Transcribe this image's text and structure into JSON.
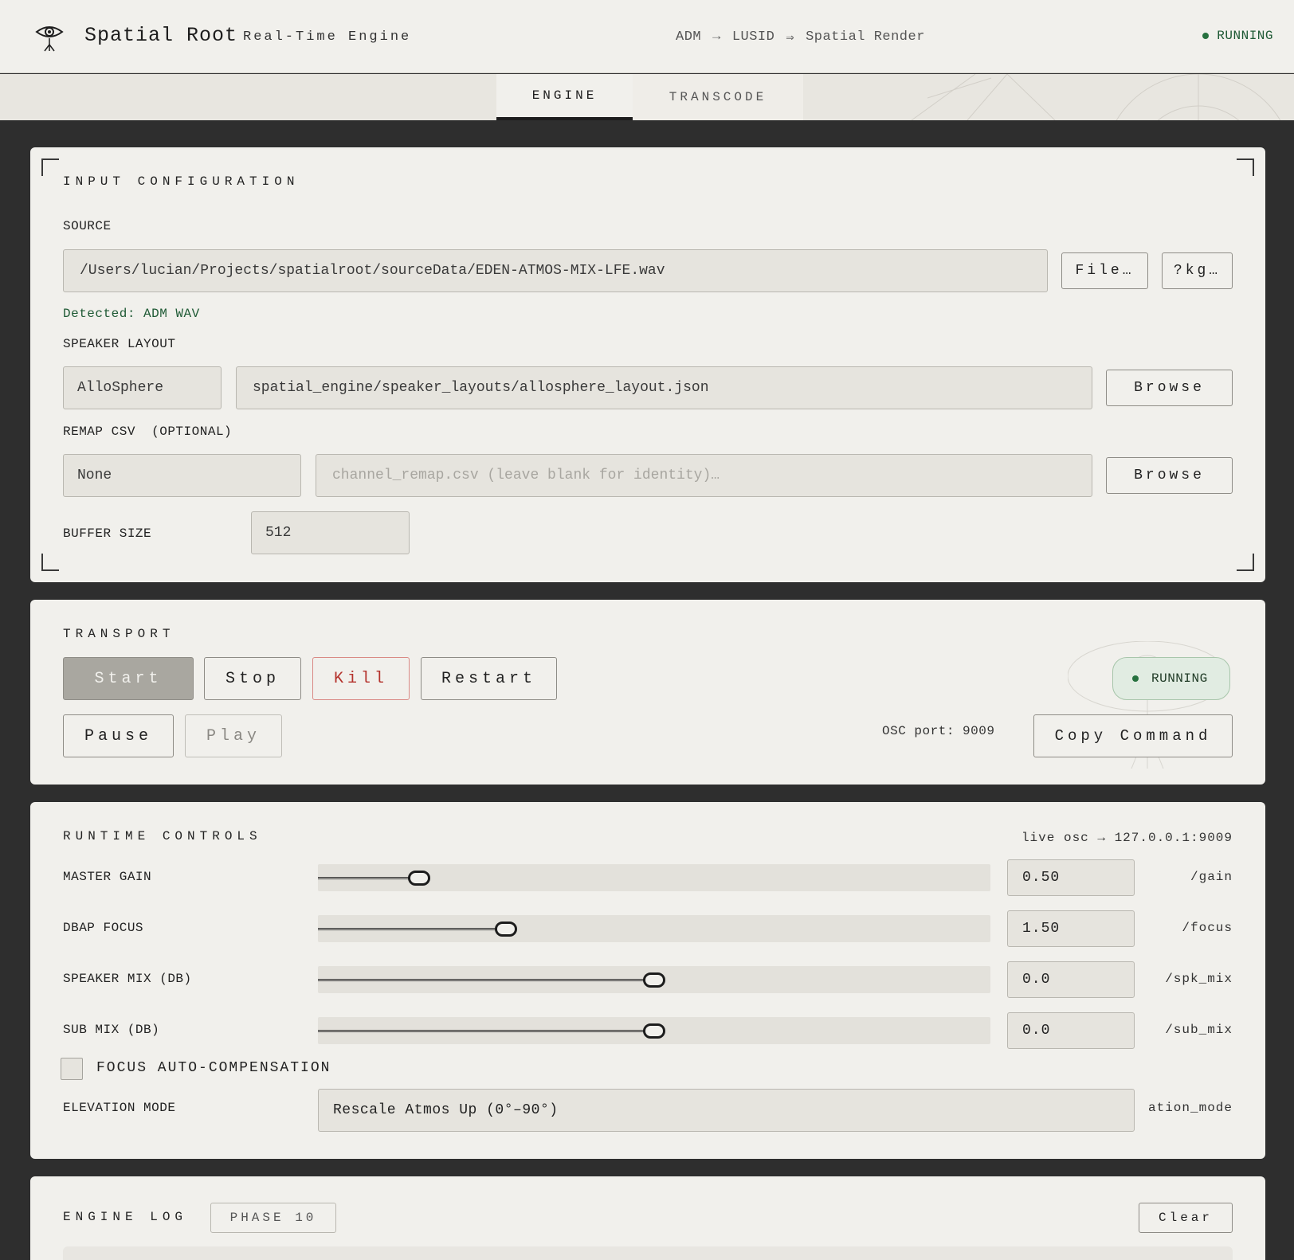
{
  "header": {
    "title": "Spatial Root",
    "subtitle": "Real-Time Engine",
    "pipeline": [
      "ADM",
      "→",
      "LUSID",
      "⇒",
      "Spatial Render"
    ],
    "status": "RUNNING"
  },
  "tabs": [
    {
      "label": "ENGINE",
      "active": true
    },
    {
      "label": "TRANSCODE",
      "active": false
    }
  ],
  "input_config": {
    "title": "INPUT CONFIGURATION",
    "source_label": "SOURCE",
    "source_value": "/Users/lucian/Projects/spatialroot/sourceData/EDEN-ATMOS-MIX-LFE.wav",
    "file_button": "File…",
    "pkg_button": "?kg…",
    "detected": "Detected: ADM WAV",
    "speaker_layout_label": "SPEAKER LAYOUT",
    "speaker_layout_preset": "AlloSphere",
    "speaker_layout_path": "spatial_engine/speaker_layouts/allosphere_layout.json",
    "browse_label": "Browse",
    "remap_label": "REMAP CSV",
    "remap_optional": "(OPTIONAL)",
    "remap_preset": "None",
    "remap_placeholder": "channel_remap.csv (leave blank for identity)…",
    "buffer_label": "BUFFER SIZE",
    "buffer_value": "512"
  },
  "transport": {
    "title": "TRANSPORT",
    "start": "Start",
    "stop": "Stop",
    "kill": "Kill",
    "restart": "Restart",
    "pause": "Pause",
    "play": "Play",
    "status": "RUNNING",
    "osc_port": "OSC port: 9009",
    "copy_command": "Copy Command"
  },
  "runtime": {
    "title": "RUNTIME CONTROLS",
    "live_osc": "live osc → 127.0.0.1:9009",
    "sliders": [
      {
        "label": "MASTER GAIN",
        "value": "0.50",
        "osc": "/gain",
        "position": 0.15
      },
      {
        "label": "DBAP FOCUS",
        "value": "1.50",
        "osc": "/focus",
        "position": 0.28
      },
      {
        "label": "SPEAKER MIX (DB)",
        "value": "0.0",
        "osc": "/spk_mix",
        "position": 0.5
      },
      {
        "label": "SUB MIX (DB)",
        "value": "0.0",
        "osc": "/sub_mix",
        "position": 0.5
      }
    ],
    "auto_comp_label": "FOCUS AUTO-COMPENSATION",
    "auto_comp_checked": false,
    "elevation_label": "ELEVATION MODE",
    "elevation_value": "Rescale Atmos Up (0°–90°)",
    "elevation_osc": "ation_mode"
  },
  "log": {
    "title": "ENGINE LOG",
    "phase": "PHASE 10",
    "clear": "Clear"
  },
  "colors": {
    "background": "#2e2e2e",
    "panel": "#f1f0ec",
    "running": "#27713f",
    "kill": "#b4322c"
  }
}
